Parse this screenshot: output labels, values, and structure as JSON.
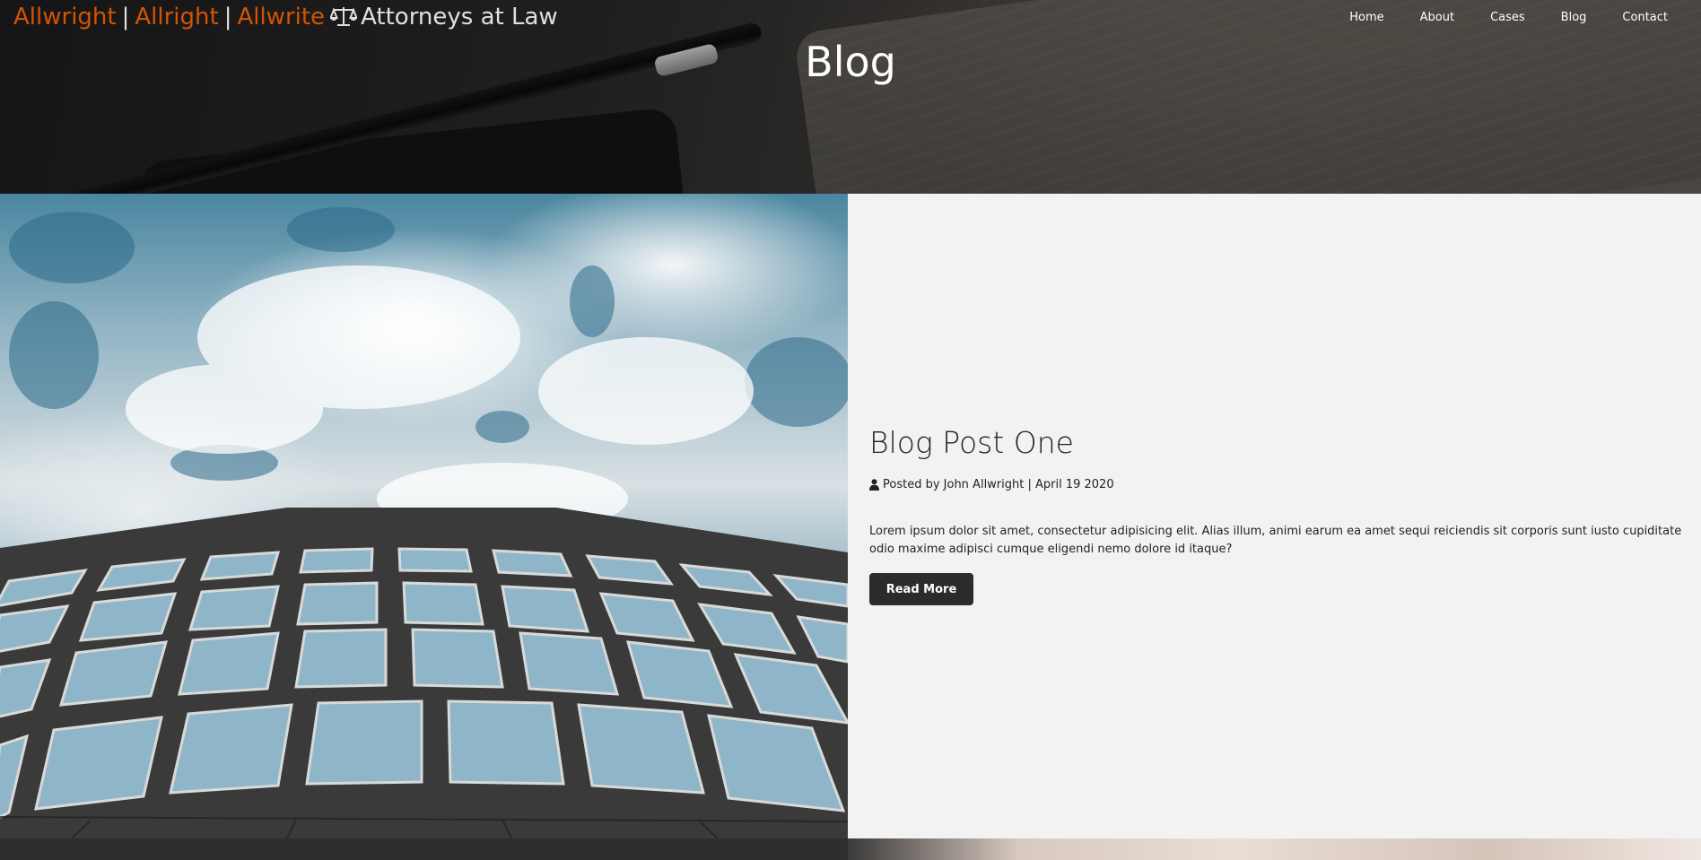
{
  "brand": {
    "name_1": "Allwright",
    "separator": "|",
    "name_2": "Allright",
    "name_3": "Allwrite",
    "tagline": "Attorneys at Law",
    "icon": "scale-icon",
    "accent_color": "#d35400"
  },
  "nav": {
    "items": [
      {
        "label": "Home"
      },
      {
        "label": "About"
      },
      {
        "label": "Cases"
      },
      {
        "label": "Blog"
      },
      {
        "label": "Contact"
      }
    ]
  },
  "hero": {
    "title": "Blog"
  },
  "post": {
    "title": "Blog Post One",
    "meta_icon": "user-icon",
    "meta": "Posted by John Allwright | April 19 2020",
    "body": "Lorem ipsum dolor sit amet, consectetur adipisicing elit. Alias illum, animi earum ea amet sequi reiciendis sit corporis sunt iusto cupiditate odio maxime adipisci cumque eligendi nemo dolore id itaque?",
    "button_label": "Read More"
  }
}
